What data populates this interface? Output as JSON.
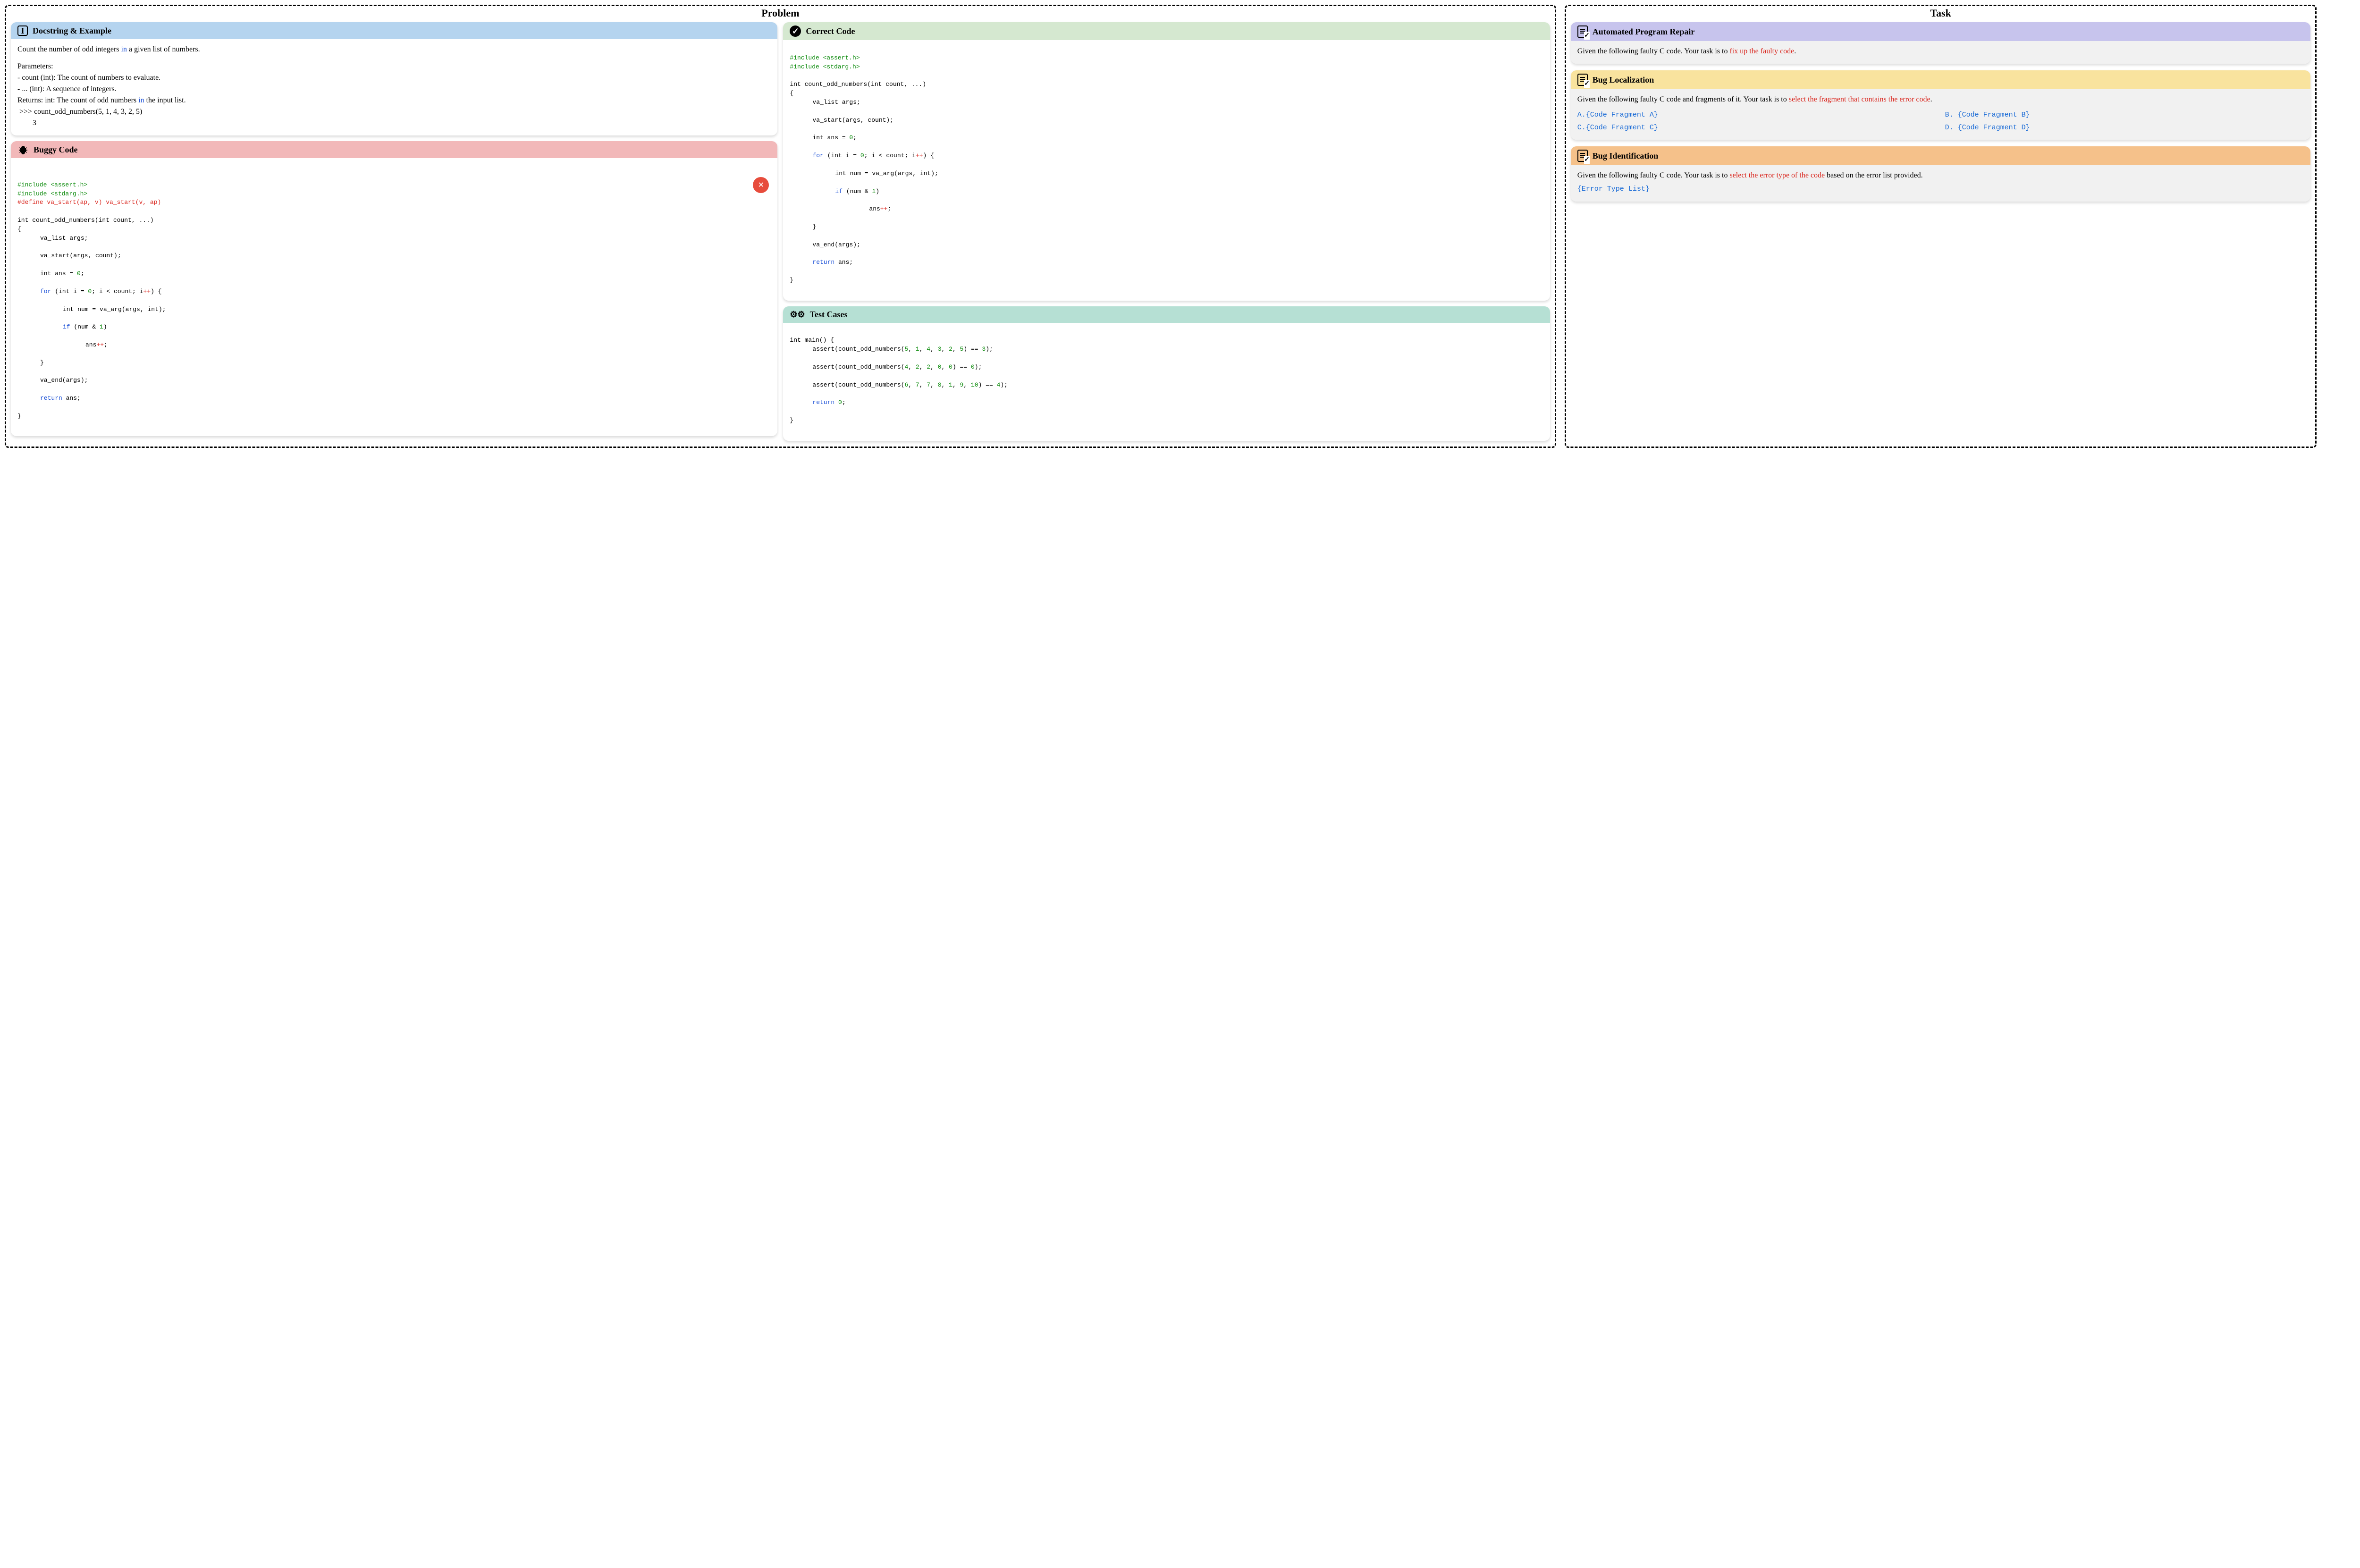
{
  "panels": {
    "problem_title": "Problem",
    "task_title": "Task"
  },
  "docstring": {
    "title": "Docstring & Example",
    "line1a": "Count the number of odd integers ",
    "line1b": "in",
    "line1c": " a given list of numbers.",
    "params_label": "Parameters:",
    "param1": "- count (int): The count of numbers to evaluate.",
    "param2": "- ...  (int): A sequence of integers.",
    "returns_a": "Returns: int: The count of odd numbers ",
    "returns_b": "in",
    "returns_c": " the input list.",
    "example_call": " >>> count_odd_numbers(5, 1, 4, 3, 2, 5)",
    "example_out": "        3"
  },
  "buggy": {
    "title": "Buggy Code",
    "inc1": "#include <assert.h>",
    "inc2": "#include <stdarg.h>",
    "define": "#define va_start(ap, v) va_start(v, ap)",
    "sig": "int count_odd_numbers(int count, ...)",
    "brace_open": "{",
    "l_va_list": "va_list args;",
    "l_va_start": "va_start(args, count);",
    "l_ans_a": "int ans = ",
    "l_ans_b": "0",
    "l_ans_c": ";",
    "l_for_a": "for",
    "l_for_b": " (int i = ",
    "l_for_c": "0",
    "l_for_d": "; i < count; i",
    "l_for_e": "++",
    "l_for_f": ") {",
    "l_num": "int num = va_arg(args, int);",
    "l_if_a": "if",
    "l_if_b": " (num & ",
    "l_if_c": "1",
    "l_if_d": ")",
    "l_anspp": "ans",
    "l_anspp2": "++",
    "l_anspp3": ";",
    "l_brace_close_inner": "}",
    "l_va_end": "va_end(args);",
    "l_return_a": "return",
    "l_return_b": " ans;",
    "brace_close": "}"
  },
  "correct": {
    "title": "Correct Code",
    "inc1": "#include <assert.h>",
    "inc2": "#include <stdarg.h>",
    "sig": "int count_odd_numbers(int count, ...)",
    "brace_open": "{",
    "l_va_list": "va_list args;",
    "l_va_start": "va_start(args, count);",
    "l_ans_a": "int ans = ",
    "l_ans_b": "0",
    "l_ans_c": ";",
    "l_for_a": "for",
    "l_for_b": " (int i = ",
    "l_for_c": "0",
    "l_for_d": "; i < count; i",
    "l_for_e": "++",
    "l_for_f": ") {",
    "l_num": "int num = va_arg(args, int);",
    "l_if_a": "if",
    "l_if_b": " (num & ",
    "l_if_c": "1",
    "l_if_d": ")",
    "l_anspp": "ans",
    "l_anspp2": "++",
    "l_anspp3": ";",
    "l_brace_close_inner": "}",
    "l_va_end": "va_end(args);",
    "l_return_a": "return",
    "l_return_b": " ans;",
    "brace_close": "}"
  },
  "tests": {
    "title": "Test Cases",
    "sig": "int main() {",
    "a1a": "assert(count_odd_numbers(",
    "a1b": "5",
    "a1c": ", ",
    "a1d": "1",
    "a1e": ", ",
    "a1f": "4",
    "a1g": ", ",
    "a1h": "3",
    "a1i": ", ",
    "a1j": "2",
    "a1k": ", ",
    "a1l": "5",
    "a1m": ") == ",
    "a1n": "3",
    "a1o": ");",
    "a2a": "assert(count_odd_numbers(",
    "a2b": "4",
    "a2c": ", ",
    "a2d": "2",
    "a2e": ", ",
    "a2f": "2",
    "a2g": ", ",
    "a2h": "0",
    "a2i": ", ",
    "a2j": "0",
    "a2k": ") == ",
    "a2l": "0",
    "a2m": ");",
    "a3a": "assert(count_odd_numbers(",
    "a3b": "6",
    "a3c": ", ",
    "a3d": "7",
    "a3e": ", ",
    "a3f": "7",
    "a3g": ", ",
    "a3h": "8",
    "a3i": ", ",
    "a3j": "1",
    "a3k": ", ",
    "a3l": "9",
    "a3m": ", ",
    "a3n": "10",
    "a3o": ") == ",
    "a3p": "4",
    "a3q": ");",
    "ret_a": "return",
    "ret_b": " ",
    "ret_c": "0",
    "ret_d": ";",
    "brace_close": "}"
  },
  "tasks": {
    "apr": {
      "title": "Automated Program Repair",
      "text_a": "Given the following faulty C code. Your task is to ",
      "text_b": "fix up the faulty code",
      "text_c": "."
    },
    "loc": {
      "title": "Bug Localization",
      "text_a": "Given the following faulty C code and fragments of it. Your task is to ",
      "text_b": "select the fragment that contains the error code",
      "text_c": ".",
      "optA": "A.{Code Fragment A}",
      "optB": "B. {Code Fragment B}",
      "optC": "C.{Code Fragment C}",
      "optD": "D. {Code Fragment D}"
    },
    "ident": {
      "title": "Bug Identification",
      "text_a": "Given the following faulty C code. Your task is to ",
      "text_b": "select the error type of the code",
      "text_c": " based on the error list provided.",
      "list": "{Error Type List}"
    }
  }
}
